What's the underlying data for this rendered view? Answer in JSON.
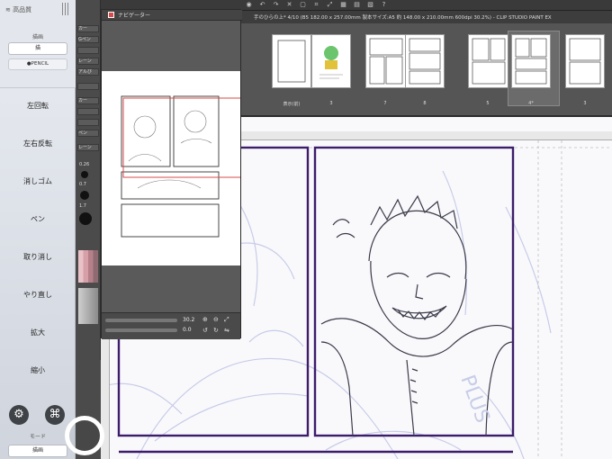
{
  "sidebar": {
    "status": "高品質",
    "group_label": "描画",
    "pill_top": "描",
    "pill_pencil": "●PENCIL",
    "buttons": [
      "左回転",
      "左右反転",
      "消しゴム",
      "ペン",
      "取り消し",
      "やり直し",
      "拡大",
      "縮小"
    ],
    "gear_icon": "⚙",
    "command_icon": "⌘",
    "mode_label": "モード",
    "pill_bottom": "描画"
  },
  "app": {
    "document_title": "手のひらの上* 4/10 (B5 182.00 x 257.00mm 製本サイズ:A5 約 148.00 x 210.00mm 600dpi 30.2%) - CLIP STUDIO PAINT EX"
  },
  "navigator": {
    "title": "ナビゲーター",
    "zoom": "30.2",
    "rotation": "0.0"
  },
  "tool_strip": {
    "rows": [
      "カー",
      "Gペン",
      "レーン",
      "",
      "アルぴ",
      "",
      "カー",
      "",
      "",
      "",
      "ペン",
      "",
      "",
      "レーン"
    ],
    "sizes": [
      "0.26",
      "0.7",
      "1.7"
    ]
  },
  "pages": [
    {
      "label": "表示(前)"
    },
    {
      "label": "3"
    },
    {
      "label": "7"
    },
    {
      "label": "8"
    },
    {
      "label": "5"
    },
    {
      "label": "4*"
    },
    {
      "label": "3"
    }
  ],
  "colors": {
    "panel_border": "#3d1c6b",
    "selection": "#d94b4b",
    "sketch": "#c6cbe6"
  }
}
